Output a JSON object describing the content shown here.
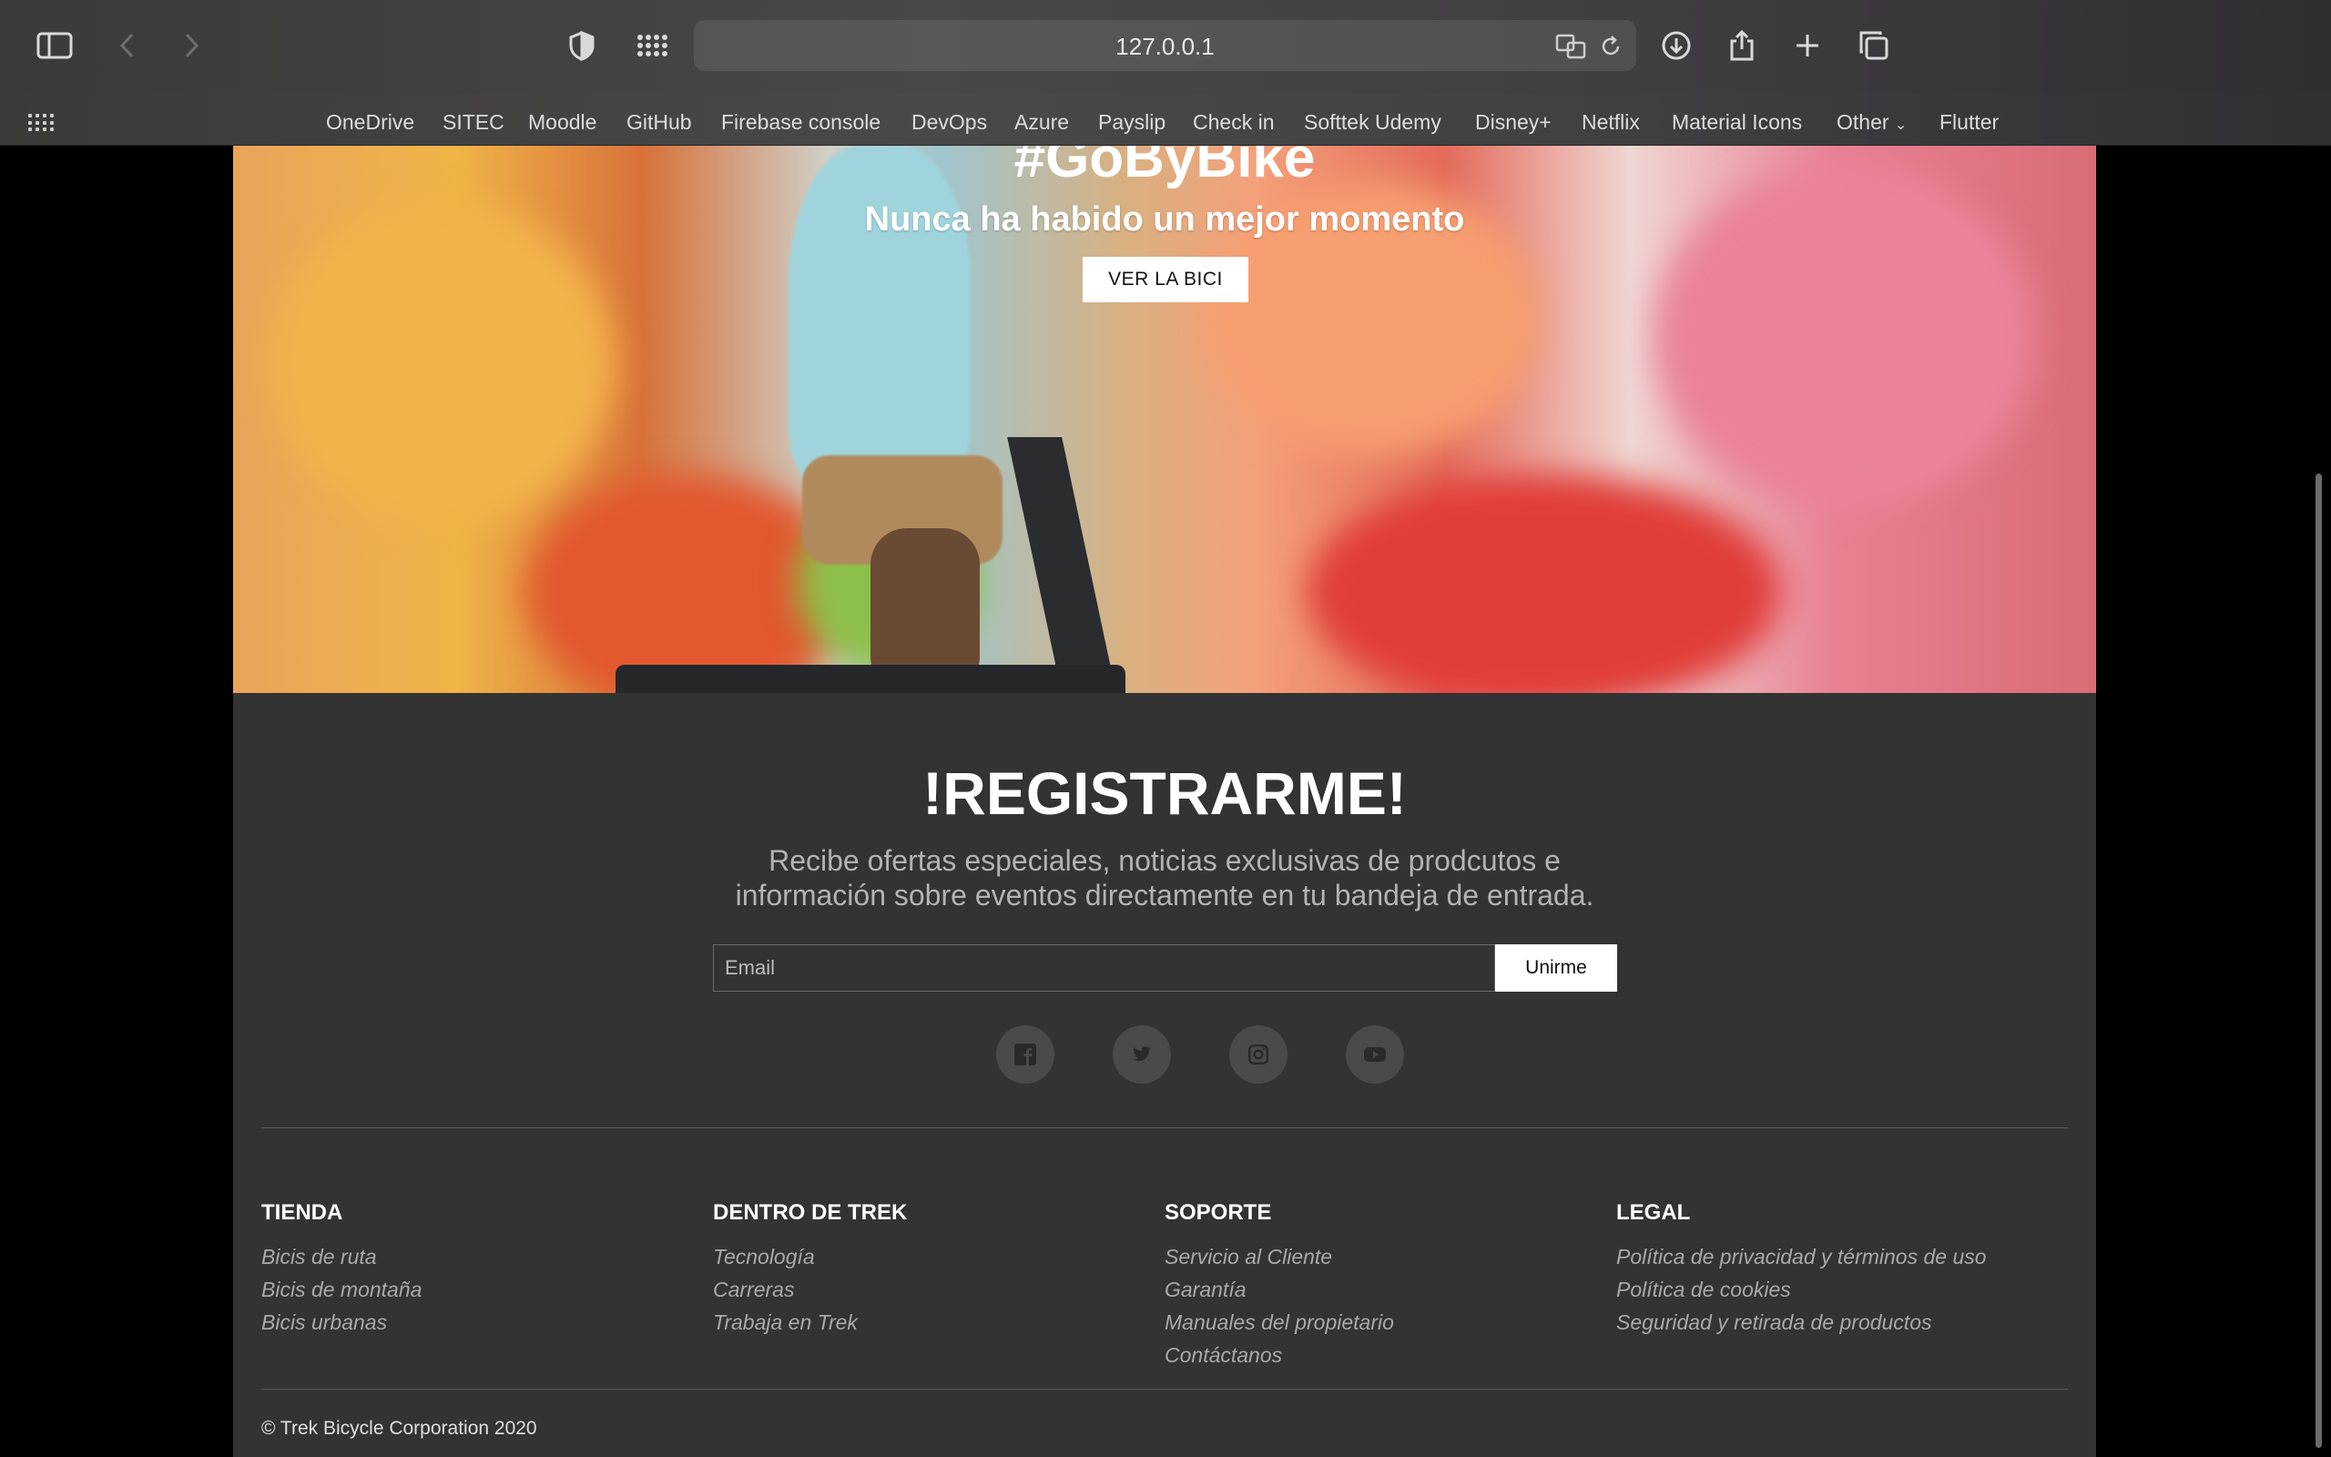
{
  "browser": {
    "url": "127.0.0.1",
    "bookmarks": [
      "OneDrive",
      "SITEC",
      "Moodle",
      "GitHub",
      "Firebase console",
      "DevOps",
      "Azure",
      "Payslip",
      "Check in",
      "Softtek Udemy",
      "Disney+",
      "Netflix",
      "Material Icons",
      "Other",
      "Flutter"
    ]
  },
  "hero": {
    "title": "#GoByBike",
    "subtitle": "Nunca ha habido un mejor momento",
    "button": "VER LA BICI"
  },
  "register": {
    "title": "!REGISTRARME!",
    "description": "Recibe ofertas especiales, noticias exclusivas de prodcutos e información sobre eventos directamente en tu bandeja de entrada.",
    "email_placeholder": "Email",
    "join_label": "Unirme"
  },
  "social": [
    "facebook-icon",
    "twitter-icon",
    "instagram-icon",
    "youtube-icon"
  ],
  "footer": {
    "columns": [
      {
        "title": "TIENDA",
        "links": [
          "Bicis de ruta",
          "Bicis de montaña",
          "Bicis urbanas"
        ]
      },
      {
        "title": "DENTRO DE TREK",
        "links": [
          "Tecnología",
          "Carreras",
          "Trabaja en Trek"
        ]
      },
      {
        "title": "SOPORTE",
        "links": [
          "Servicio al Cliente",
          "Garantía",
          "Manuales del propietario",
          "Contáctanos"
        ]
      },
      {
        "title": "LEGAL",
        "links": [
          "Política de privacidad y términos de uso",
          "Política de cookies",
          "Seguridad y retirada de productos"
        ]
      }
    ],
    "copyright": "© Trek Bicycle Corporation 2020"
  }
}
